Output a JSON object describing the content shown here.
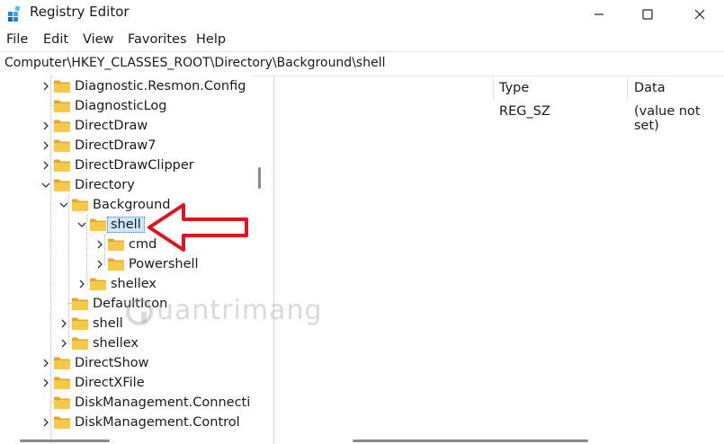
{
  "window": {
    "title": "Registry Editor"
  },
  "menu": [
    "File",
    "Edit",
    "View",
    "Favorites",
    "Help"
  ],
  "address": "Computer\\HKEY_CLASSES_ROOT\\Directory\\Background\\shell",
  "tree": [
    {
      "label": "Diagnostic.Resmon.Config",
      "expander": "collapsed",
      "depth": 0
    },
    {
      "label": "DiagnosticLog",
      "expander": "none",
      "depth": 0
    },
    {
      "label": "DirectDraw",
      "expander": "collapsed",
      "depth": 0
    },
    {
      "label": "DirectDraw7",
      "expander": "collapsed",
      "depth": 0
    },
    {
      "label": "DirectDrawClipper",
      "expander": "collapsed",
      "depth": 0
    },
    {
      "label": "Directory",
      "expander": "expanded",
      "depth": 0
    },
    {
      "label": "Background",
      "expander": "expanded",
      "depth": 1
    },
    {
      "label": "shell",
      "expander": "expanded",
      "depth": 2,
      "selected": true
    },
    {
      "label": "cmd",
      "expander": "collapsed",
      "depth": 3
    },
    {
      "label": "Powershell",
      "expander": "collapsed",
      "depth": 3
    },
    {
      "label": "shellex",
      "expander": "collapsed",
      "depth": 2
    },
    {
      "label": "DefaultIcon",
      "expander": "none",
      "depth": 1
    },
    {
      "label": "shell",
      "expander": "collapsed",
      "depth": 1
    },
    {
      "label": "shellex",
      "expander": "collapsed",
      "depth": 1
    },
    {
      "label": "DirectShow",
      "expander": "collapsed",
      "depth": 0
    },
    {
      "label": "DirectXFile",
      "expander": "collapsed",
      "depth": 0
    },
    {
      "label": "DiskManagement.Connection",
      "expander": "none",
      "depth": 0
    },
    {
      "label": "DiskManagement.Control",
      "expander": "collapsed",
      "depth": 0
    }
  ],
  "list": {
    "columns": {
      "type": "Type",
      "data": "Data"
    },
    "rows": [
      {
        "type": "REG_SZ",
        "data": "(value not set)"
      }
    ]
  },
  "watermark": "uantrimang",
  "colors": {
    "folder": "#f7c948",
    "folder_dark": "#e0a82e",
    "selection": "#cde8ff",
    "annotation_arrow": "#e0141e"
  }
}
